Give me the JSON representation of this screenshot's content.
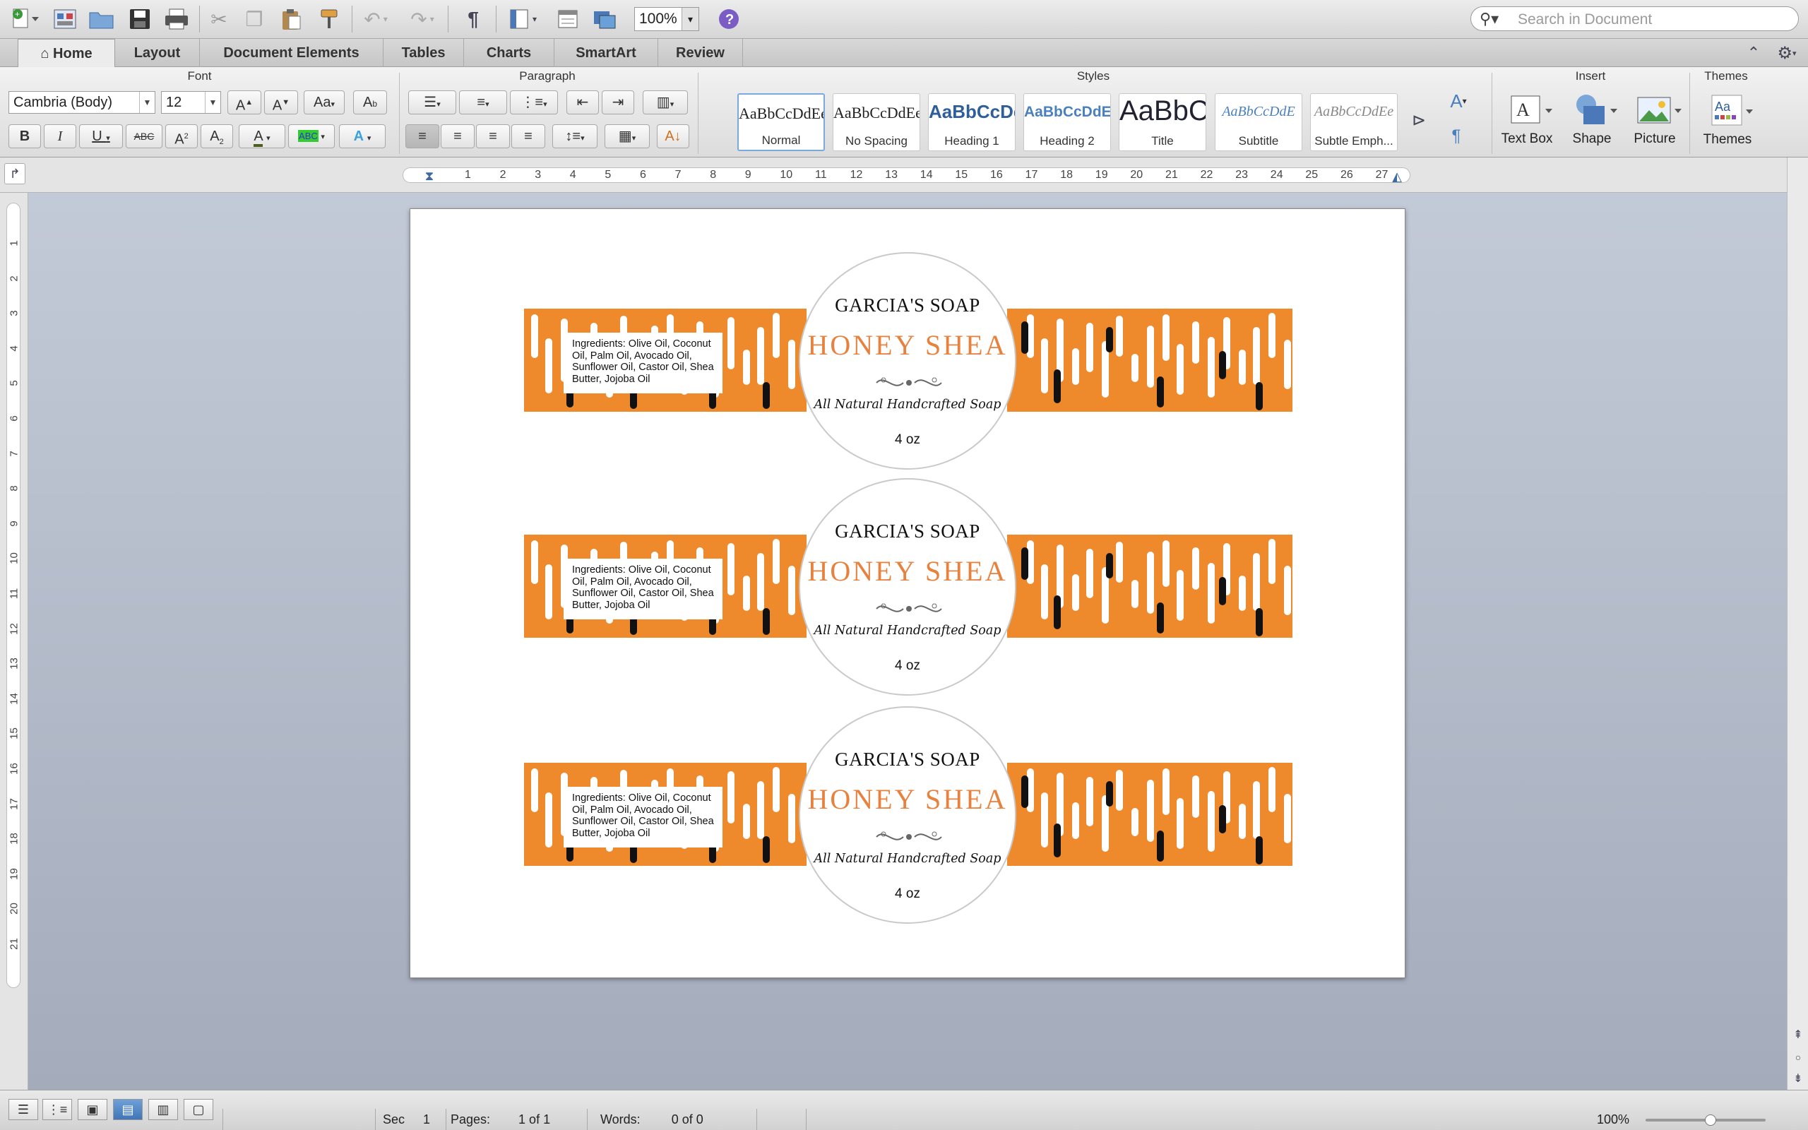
{
  "toolbar": {
    "zoom": "100%",
    "search_placeholder": "Search in Document",
    "icons": [
      "new-icon",
      "templates-icon",
      "open-icon",
      "save-icon",
      "print-icon",
      "cut-icon",
      "copy-icon",
      "paste-icon",
      "format-painter-icon",
      "undo-icon",
      "redo-icon",
      "pilcrow-icon",
      "sidebar-icon",
      "toolbox-icon",
      "media-browser-icon",
      "help-icon"
    ]
  },
  "tabs": [
    "Home",
    "Layout",
    "Document Elements",
    "Tables",
    "Charts",
    "SmartArt",
    "Review"
  ],
  "ribbon": {
    "groups": {
      "font": "Font",
      "paragraph": "Paragraph",
      "styles": "Styles",
      "insert": "Insert",
      "themes": "Themes"
    },
    "font_name": "Cambria (Body)",
    "font_size": "12",
    "styles": [
      {
        "preview": "AaBbCcDdEe",
        "name": "Normal"
      },
      {
        "preview": "AaBbCcDdEe",
        "name": "No Spacing"
      },
      {
        "preview": "AaBbCcDe",
        "name": "Heading 1"
      },
      {
        "preview": "AaBbCcDdEe",
        "name": "Heading 2"
      },
      {
        "preview": "AaBbC",
        "name": "Title"
      },
      {
        "preview": "AaBbCcDdE",
        "name": "Subtitle"
      },
      {
        "preview": "AaBbCcDdEe",
        "name": "Subtle Emph..."
      }
    ],
    "insert": [
      "Text Box",
      "Shape",
      "Picture"
    ],
    "themes": "Themes",
    "themes_preview": "Aa"
  },
  "ruler": {
    "h": [
      "1",
      "2",
      "3",
      "4",
      "5",
      "6",
      "7",
      "8",
      "9",
      "10",
      "11",
      "12",
      "13",
      "14",
      "15",
      "16",
      "17",
      "18",
      "19",
      "20",
      "21",
      "22",
      "23",
      "24",
      "25",
      "26",
      "27"
    ],
    "v": [
      "1",
      "2",
      "3",
      "4",
      "5",
      "6",
      "7",
      "8",
      "9",
      "10",
      "11",
      "12",
      "13",
      "14",
      "15",
      "16",
      "17",
      "18",
      "19",
      "20",
      "21"
    ]
  },
  "labels": [
    {
      "brand": "GARCIA'S SOAP",
      "product": "HONEY SHEA",
      "tagline": "All Natural Handcrafted Soap",
      "weight": "4 oz",
      "ingredients": "Ingredients: Olive Oil, Coconut Oil, Palm Oil, Avocado Oil, Sunflower Oil, Castor Oil, Shea Butter, Jojoba Oil"
    },
    {
      "brand": "GARCIA'S SOAP",
      "product": "HONEY SHEA",
      "tagline": "All Natural Handcrafted Soap",
      "weight": "4 oz",
      "ingredients": "Ingredients: Olive Oil, Coconut Oil, Palm Oil, Avocado Oil, Sunflower Oil, Castor Oil, Shea Butter, Jojoba Oil"
    },
    {
      "brand": "GARCIA'S SOAP",
      "product": "HONEY SHEA",
      "tagline": "All Natural Handcrafted Soap",
      "weight": "4 oz",
      "ingredients": "Ingredients: Olive Oil, Coconut Oil, Palm Oil, Avocado Oil, Sunflower Oil, Castor Oil, Shea Butter, Jojoba Oil"
    }
  ],
  "colors": {
    "band": "#ef8a2c",
    "product_text": "#e8813d",
    "accent": "#3f76b8"
  },
  "status": {
    "sec_label": "Sec",
    "sec_value": "1",
    "pages_label": "Pages:",
    "pages_value": "1 of 1",
    "words_label": "Words:",
    "words_value": "0 of 0",
    "zoom": "100%"
  }
}
